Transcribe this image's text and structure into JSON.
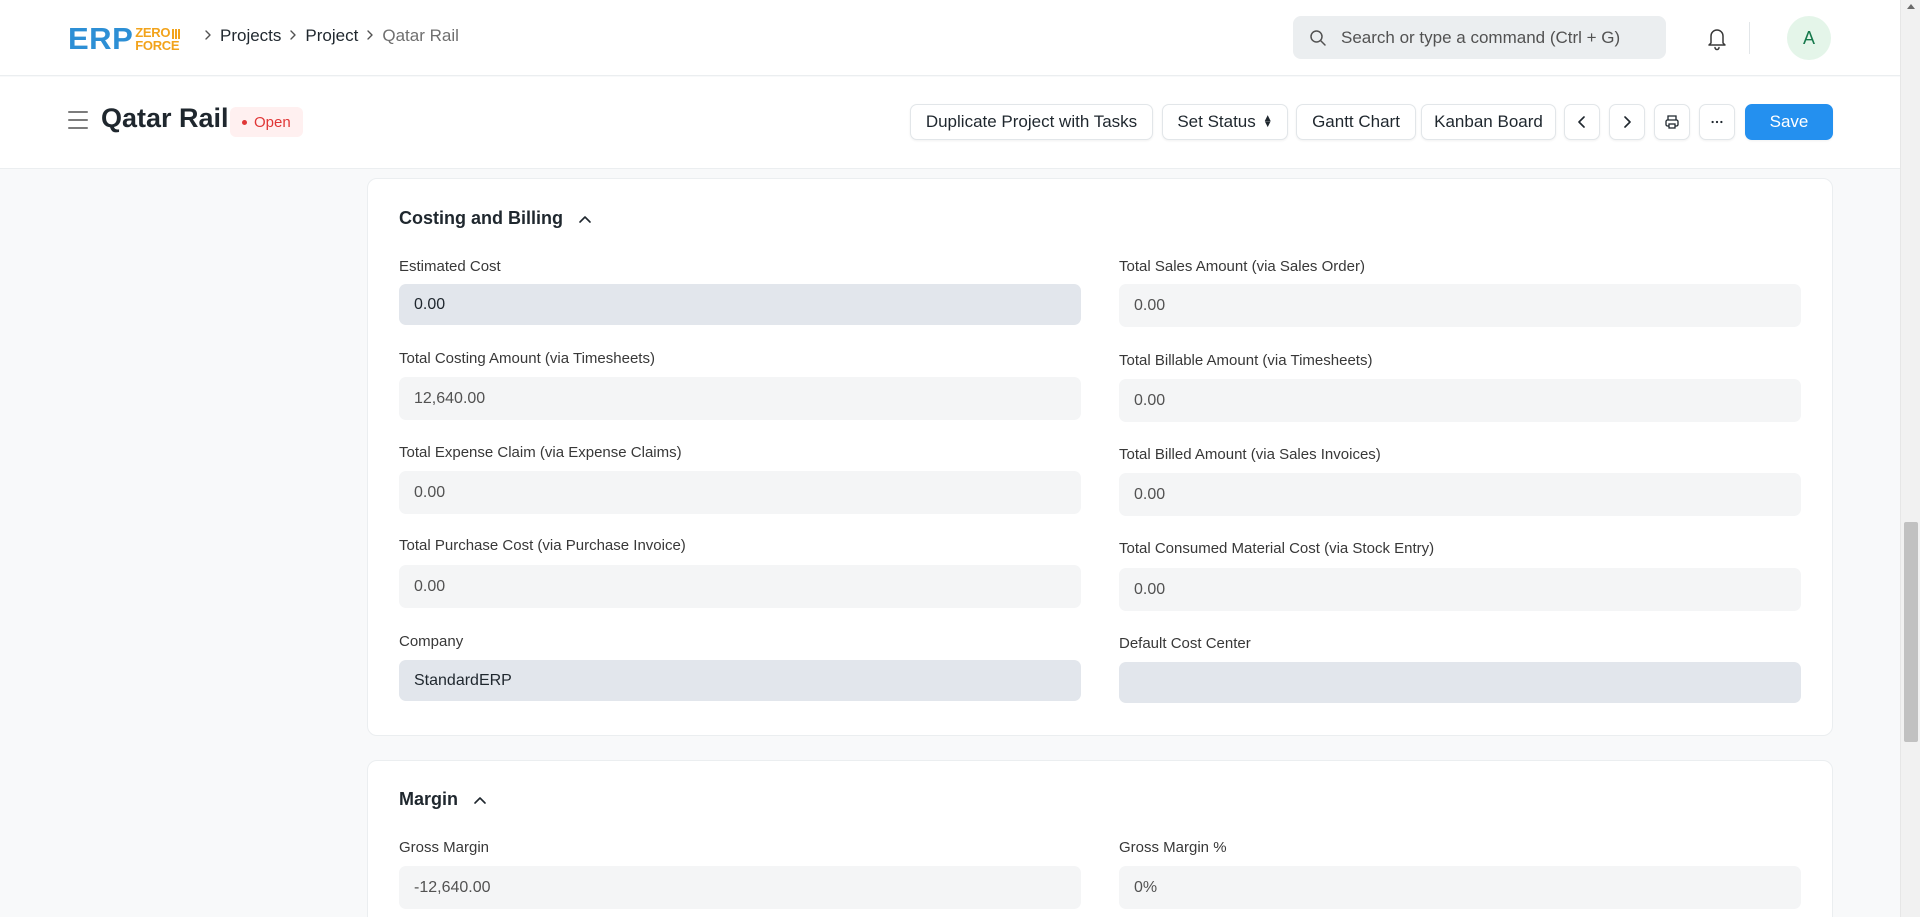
{
  "navbar": {
    "logo": {
      "main": "ERP",
      "sub_top": "ZERO",
      "sub_bottom": "FORCE"
    },
    "breadcrumbs": [
      "Projects",
      "Project",
      "Qatar Rail"
    ],
    "search_placeholder": "Search or type a command (Ctrl + G)",
    "avatar_initial": "A",
    "icons": {
      "search": "search-icon",
      "notifications": "bell-icon",
      "separator": "chevron-right-icon"
    }
  },
  "page_head": {
    "title": "Qatar Rail",
    "status": "Open",
    "status_color": "#e03636",
    "buttons": {
      "duplicate": "Duplicate Project with Tasks",
      "set_status": "Set Status",
      "gantt": "Gantt Chart",
      "kanban": "Kanban Board",
      "save": "Save"
    },
    "icons": {
      "prev": "chevron-left-icon",
      "next": "chevron-right-icon",
      "print": "printer-icon",
      "more": "more-horizontal-icon",
      "menu": "hamburger-icon"
    },
    "primary_color": "#2490ef"
  },
  "costing": {
    "title": "Costing and Billing",
    "left": [
      {
        "label": "Estimated Cost",
        "value": "0.00"
      },
      {
        "label": "Total Costing Amount (via Timesheets)",
        "value": "12,640.00"
      },
      {
        "label": "Total Expense Claim (via Expense Claims)",
        "value": "0.00"
      },
      {
        "label": "Total Purchase Cost (via Purchase Invoice)",
        "value": "0.00"
      },
      {
        "label": "Company",
        "value": "StandardERP"
      }
    ],
    "right": [
      {
        "label": "Total Sales Amount (via Sales Order)",
        "value": "0.00"
      },
      {
        "label": "Total Billable Amount (via Timesheets)",
        "value": "0.00"
      },
      {
        "label": "Total Billed Amount (via Sales Invoices)",
        "value": "0.00"
      },
      {
        "label": "Total Consumed Material Cost (via Stock Entry)",
        "value": "0.00"
      },
      {
        "label": "Default Cost Center",
        "value": ""
      }
    ]
  },
  "margin": {
    "title": "Margin",
    "left": [
      {
        "label": "Gross Margin",
        "value": "-12,640.00"
      }
    ],
    "right": [
      {
        "label": "Gross Margin %",
        "value": "0%"
      }
    ]
  }
}
